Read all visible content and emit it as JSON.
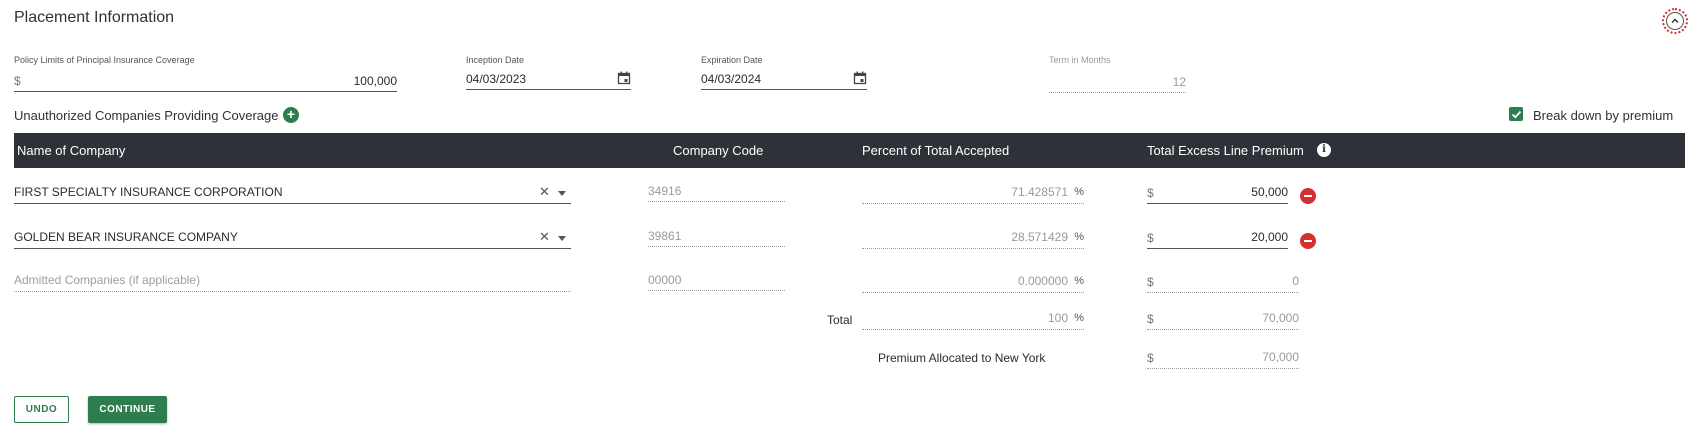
{
  "section": {
    "title": "Placement Information",
    "collapse_icon": "chevron-up-icon"
  },
  "policy_limits": {
    "label": "Policy Limits of Principal Insurance Coverage",
    "currency": "$",
    "value": "100,000"
  },
  "inception": {
    "label": "Inception Date",
    "value": "04/03/2023"
  },
  "expiration": {
    "label": "Expiration Date",
    "value": "04/03/2024"
  },
  "term": {
    "label": "Term in Months",
    "value": "12"
  },
  "unauthorized": {
    "label": "Unauthorized Companies Providing Coverage"
  },
  "breakdown": {
    "label": "Break down by premium",
    "checked": true
  },
  "table": {
    "headers": {
      "name": "Name of Company",
      "code": "Company Code",
      "percent": "Percent of Total Accepted",
      "premium": "Total Excess Line Premium"
    },
    "rows": [
      {
        "name": "FIRST SPECIALTY INSURANCE CORPORATION",
        "code": "34916",
        "percent": "71.428571",
        "premium": "50,000"
      },
      {
        "name": "GOLDEN BEAR INSURANCE COMPANY",
        "code": "39861",
        "percent": "28.571429",
        "premium": "20,000"
      }
    ],
    "admitted": {
      "placeholder": "Admitted Companies (if applicable)",
      "code": "00000",
      "percent": "0.000000",
      "premium": "0"
    },
    "total": {
      "label": "Total",
      "percent": "100",
      "premium": "70,000"
    },
    "ny": {
      "label": "Premium Allocated to New York",
      "premium": "70,000"
    },
    "percent_symbol": "%",
    "currency": "$"
  },
  "buttons": {
    "undo": "UNDO",
    "continue": "CONTINUE"
  },
  "colors": {
    "accent": "#2e7d4f",
    "header_bg": "#2e3238",
    "danger": "#d32f2f"
  }
}
